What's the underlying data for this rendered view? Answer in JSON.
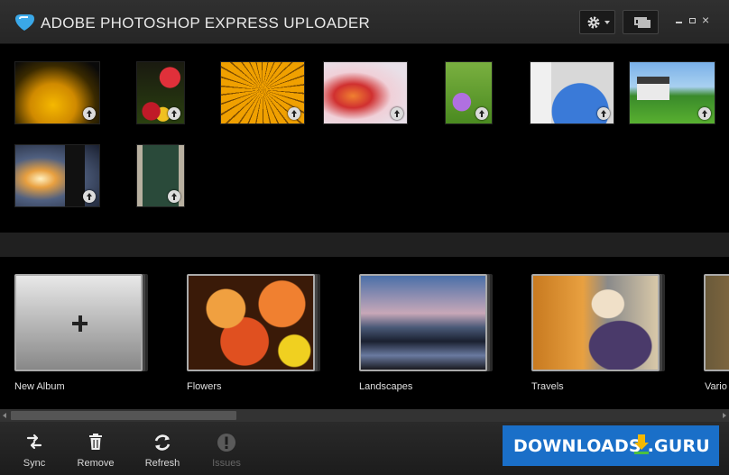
{
  "app": {
    "title": "ADOBE PHOTOSHOP EXPRESS UPLOADER"
  },
  "window_controls": {
    "settings_icon": "gear-icon",
    "switch_view_icon": "windows-icon",
    "minimize": "minimize-icon",
    "maximize": "maximize-icon",
    "close_symbol": "×"
  },
  "photos": [
    {
      "subject": "yellow-flower",
      "icon": "upload-icon"
    },
    {
      "subject": "tulips",
      "icon": "upload-icon"
    },
    {
      "subject": "paper-umbrella",
      "icon": "upload-icon"
    },
    {
      "subject": "orchid",
      "icon": "upload-icon"
    },
    {
      "subject": "purple-flower",
      "icon": "upload-icon"
    },
    {
      "subject": "arch",
      "icon": "upload-icon"
    },
    {
      "subject": "chapel",
      "icon": "upload-icon"
    },
    {
      "subject": "sunset-pagoda",
      "icon": "upload-icon"
    },
    {
      "subject": "door",
      "icon": "upload-icon"
    }
  ],
  "albums": [
    {
      "label": "New Album"
    },
    {
      "label": "Flowers"
    },
    {
      "label": "Landscapes"
    },
    {
      "label": "Travels"
    },
    {
      "label": "Vario"
    }
  ],
  "toolbar": {
    "sync_label": "Sync",
    "remove_label": "Remove",
    "refresh_label": "Refresh",
    "issues_label": "Issues"
  },
  "watermark": {
    "text": "DOWNLOADS  .GURU"
  },
  "colors": {
    "background": "#000000",
    "titlebar": "#2a2a2a",
    "watermark": "#1a6fc8"
  }
}
